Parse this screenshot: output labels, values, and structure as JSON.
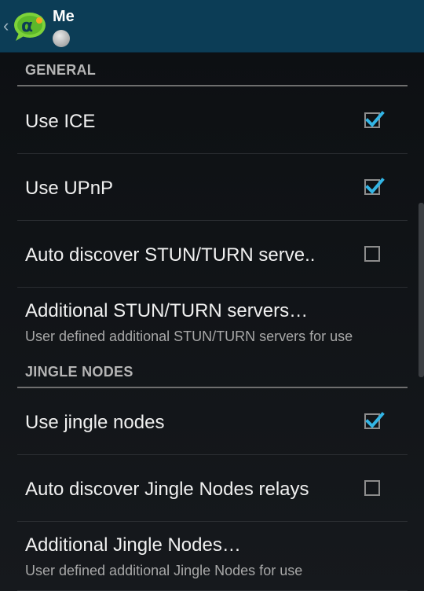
{
  "actionbar": {
    "title": "Me",
    "back_icon": "chevron-left-icon",
    "logo_icon": "jitsi-alpha-logo"
  },
  "sections": {
    "general": {
      "label": "GENERAL"
    },
    "jingle": {
      "label": "JINGLE NODES"
    }
  },
  "prefs": {
    "use_ice": {
      "title": "Use ICE",
      "checked": true
    },
    "use_upnp": {
      "title": "Use UPnP",
      "checked": true
    },
    "auto_stun": {
      "title": "Auto discover STUN/TURN serve..",
      "checked": false
    },
    "additional_stun": {
      "title": "Additional STUN/TURN servers…",
      "summary": "User defined additional STUN/TURN servers for use"
    },
    "use_jingle": {
      "title": "Use jingle nodes",
      "checked": true
    },
    "auto_jingle": {
      "title": "Auto discover Jingle Nodes relays",
      "checked": false
    },
    "additional_jingle": {
      "title": "Additional Jingle Nodes…",
      "summary": "User defined additional Jingle Nodes for use"
    }
  },
  "colors": {
    "actionbar": "#0c3d56",
    "check_accent": "#33b5e5",
    "background": "#0f1114"
  }
}
